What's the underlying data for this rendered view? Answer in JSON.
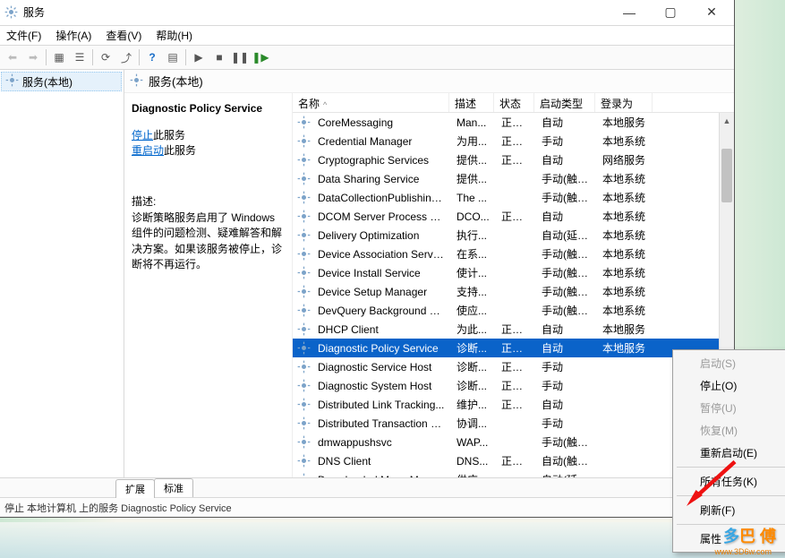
{
  "window": {
    "title": "服务"
  },
  "menu": {
    "file": "文件(F)",
    "action": "操作(A)",
    "view": "查看(V)",
    "help": "帮助(H)"
  },
  "tree": {
    "root": "服务(本地)"
  },
  "content": {
    "title": "服务(本地)"
  },
  "detail": {
    "service_name": "Diagnostic Policy Service",
    "stop_link": "停止",
    "restart_link": "重启动",
    "svc_suffix": "此服务",
    "desc_label": "描述:",
    "desc_text": "诊断策略服务启用了 Windows 组件的问题检测、疑难解答和解决方案。如果该服务被停止，诊断将不再运行。"
  },
  "columns": {
    "name": "名称",
    "desc": "描述",
    "status": "状态",
    "startup": "启动类型",
    "logon": "登录为"
  },
  "services": [
    {
      "name": "CoreMessaging",
      "desc": "Man...",
      "status": "正在...",
      "startup": "自动",
      "logon": "本地服务"
    },
    {
      "name": "Credential Manager",
      "desc": "为用...",
      "status": "正在...",
      "startup": "手动",
      "logon": "本地系统"
    },
    {
      "name": "Cryptographic Services",
      "desc": "提供...",
      "status": "正在...",
      "startup": "自动",
      "logon": "网络服务"
    },
    {
      "name": "Data Sharing Service",
      "desc": "提供...",
      "status": "",
      "startup": "手动(触发...",
      "logon": "本地系统"
    },
    {
      "name": "DataCollectionPublishing...",
      "desc": "The ...",
      "status": "",
      "startup": "手动(触发...",
      "logon": "本地系统"
    },
    {
      "name": "DCOM Server Process La...",
      "desc": "DCO...",
      "status": "正在...",
      "startup": "自动",
      "logon": "本地系统"
    },
    {
      "name": "Delivery Optimization",
      "desc": "执行...",
      "status": "",
      "startup": "自动(延迟...",
      "logon": "本地系统"
    },
    {
      "name": "Device Association Service",
      "desc": "在系...",
      "status": "",
      "startup": "手动(触发...",
      "logon": "本地系统"
    },
    {
      "name": "Device Install Service",
      "desc": "使计...",
      "status": "",
      "startup": "手动(触发...",
      "logon": "本地系统"
    },
    {
      "name": "Device Setup Manager",
      "desc": "支持...",
      "status": "",
      "startup": "手动(触发...",
      "logon": "本地系统"
    },
    {
      "name": "DevQuery Background D...",
      "desc": "使应...",
      "status": "",
      "startup": "手动(触发...",
      "logon": "本地系统"
    },
    {
      "name": "DHCP Client",
      "desc": "为此...",
      "status": "正在...",
      "startup": "自动",
      "logon": "本地服务"
    },
    {
      "name": "Diagnostic Policy Service",
      "desc": "诊断...",
      "status": "正在...",
      "startup": "自动",
      "logon": "本地服务",
      "selected": true
    },
    {
      "name": "Diagnostic Service Host",
      "desc": "诊断...",
      "status": "正在...",
      "startup": "手动",
      "logon": ""
    },
    {
      "name": "Diagnostic System Host",
      "desc": "诊断...",
      "status": "正在...",
      "startup": "手动",
      "logon": ""
    },
    {
      "name": "Distributed Link Tracking...",
      "desc": "维护...",
      "status": "正在...",
      "startup": "自动",
      "logon": ""
    },
    {
      "name": "Distributed Transaction C...",
      "desc": "协调...",
      "status": "",
      "startup": "手动",
      "logon": ""
    },
    {
      "name": "dmwappushsvc",
      "desc": "WAP...",
      "status": "",
      "startup": "手动(触发...",
      "logon": ""
    },
    {
      "name": "DNS Client",
      "desc": "DNS...",
      "status": "正在...",
      "startup": "自动(触发...",
      "logon": ""
    },
    {
      "name": "Downloaded Maps Man...",
      "desc": "供应...",
      "status": "",
      "startup": "自动(延迟...",
      "logon": ""
    }
  ],
  "tabs": {
    "extended": "扩展",
    "standard": "标准"
  },
  "statusbar": "停止 本地计算机 上的服务 Diagnostic Policy Service",
  "context": {
    "start": "启动(S)",
    "stop": "停止(O)",
    "pause": "暂停(U)",
    "resume": "恢复(M)",
    "restart": "重新启动(E)",
    "all_tasks": "所有任务(K)",
    "refresh": "刷新(F)",
    "properties": "属性"
  },
  "watermark": {
    "part1": "多",
    "part2": "巴 傅",
    "url": "www.3D6w.com"
  }
}
